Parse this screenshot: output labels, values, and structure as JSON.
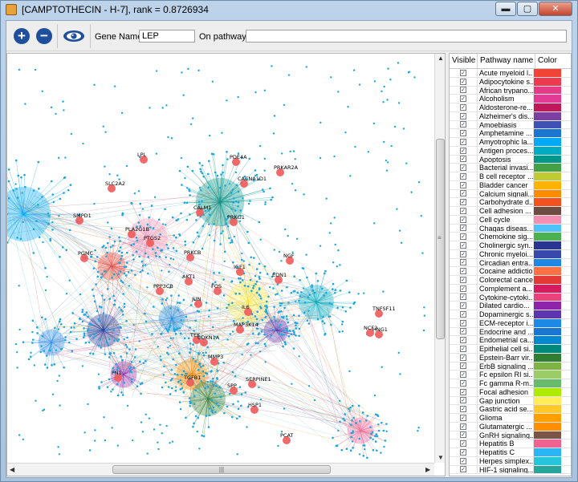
{
  "window": {
    "title": "[CAMPTOTHECIN - H-7], rank = 0.8726934",
    "minimize_label": "▬",
    "maximize_label": "▢",
    "close_label": "✕"
  },
  "toolbar": {
    "zoom_in_label": "+",
    "zoom_out_label": "−",
    "gene_name_label": "Gene Name:",
    "gene_name_value": "LEP",
    "pathways_label": "On pathways:",
    "pathways_value": ""
  },
  "graph": {
    "nodes": [
      {
        "label": "LPL"
      },
      {
        "label": "PDE4A"
      },
      {
        "label": "PRKAR2A"
      },
      {
        "label": "SLC2A2"
      },
      {
        "label": "CACNA1D1"
      },
      {
        "label": "CALM1"
      },
      {
        "label": "SMPD1"
      },
      {
        "label": "PRKG1"
      },
      {
        "label": "PLA2G1B"
      },
      {
        "label": "PTGS2"
      },
      {
        "label": "PGMC"
      },
      {
        "label": "PRKCB"
      },
      {
        "label": "IGF1"
      },
      {
        "label": "NGF"
      },
      {
        "label": "EDN1"
      },
      {
        "label": "AKT1"
      },
      {
        "label": "PPP3CB"
      },
      {
        "label": "FOS"
      },
      {
        "label": "JUN"
      },
      {
        "label": "IL6"
      },
      {
        "label": "TNFSF11"
      },
      {
        "label": "NCF2"
      },
      {
        "label": "MAP3K14"
      },
      {
        "label": "TEK"
      },
      {
        "label": "CDKN1A"
      },
      {
        "label": "HNG1"
      },
      {
        "label": "MMP3"
      },
      {
        "label": "FN1"
      },
      {
        "label": "TGFB1"
      },
      {
        "label": "SERPINE1"
      },
      {
        "label": "SPP"
      },
      {
        "label": "HSP1"
      },
      {
        "label": "PCAT"
      }
    ],
    "hscroll_grip": "|||",
    "vscroll_grip": "≡"
  },
  "table": {
    "headers": [
      "Visible",
      "Pathway name",
      "Color"
    ],
    "rows": [
      {
        "name": "Acute myeloid l...",
        "color": "#f04437"
      },
      {
        "name": "Adipocytokine s...",
        "color": "#ee3a4f"
      },
      {
        "name": "African trypano...",
        "color": "#e73a86"
      },
      {
        "name": "Alcoholism",
        "color": "#e23b95"
      },
      {
        "name": "Aldosterone-re...",
        "color": "#c2185b"
      },
      {
        "name": "Alzheimer's dis...",
        "color": "#7b3fa0"
      },
      {
        "name": "Amoebiasis",
        "color": "#3f51b5"
      },
      {
        "name": "Amphetamine ...",
        "color": "#1976d2"
      },
      {
        "name": "Amyotrophic la...",
        "color": "#03a9f4"
      },
      {
        "name": "Antigen proces...",
        "color": "#00acc1"
      },
      {
        "name": "Apoptosis",
        "color": "#009688"
      },
      {
        "name": "Bacterial invasi...",
        "color": "#43a047"
      },
      {
        "name": "B cell receptor ...",
        "color": "#c0ca33"
      },
      {
        "name": "Bladder cancer",
        "color": "#ffb300"
      },
      {
        "name": "Calcium signali...",
        "color": "#fb8c00"
      },
      {
        "name": "Carbohydrate d...",
        "color": "#f4511e"
      },
      {
        "name": "Cell adhesion ...",
        "color": "#6d4c41"
      },
      {
        "name": "Cell cycle",
        "color": "#f48fb1"
      },
      {
        "name": "Chagas diseas...",
        "color": "#4fc3f7"
      },
      {
        "name": "Chemokine sig...",
        "color": "#4caf50"
      },
      {
        "name": "Cholinergic syn...",
        "color": "#283593"
      },
      {
        "name": "Chronic myeloi...",
        "color": "#3949ab"
      },
      {
        "name": "Circadian entra...",
        "color": "#1e88e5"
      },
      {
        "name": "Cocaine addiction",
        "color": "#ff7043"
      },
      {
        "name": "Colorectal cancer",
        "color": "#e53935"
      },
      {
        "name": "Complement a...",
        "color": "#d81b60"
      },
      {
        "name": "Cytokine-cytoki...",
        "color": "#ec407a"
      },
      {
        "name": "Dilated cardio...",
        "color": "#8e24aa"
      },
      {
        "name": "Dopaminergic s...",
        "color": "#5e35b1"
      },
      {
        "name": "ECM-receptor i...",
        "color": "#1e88e5"
      },
      {
        "name": "Endocrine and ...",
        "color": "#1976d2"
      },
      {
        "name": "Endometrial ca...",
        "color": "#0288d1"
      },
      {
        "name": "Epithelial cell si...",
        "color": "#00897b"
      },
      {
        "name": "Epstein-Barr vir...",
        "color": "#2e7d32"
      },
      {
        "name": "ErbB signaling ...",
        "color": "#7cb342"
      },
      {
        "name": "Fc epsilon RI si...",
        "color": "#9ccc65"
      },
      {
        "name": "Fc gamma R-m...",
        "color": "#66bb6a"
      },
      {
        "name": "Focal adhesion",
        "color": "#aeea00"
      },
      {
        "name": "Gap junction",
        "color": "#ffee58"
      },
      {
        "name": "Gastric acid se...",
        "color": "#ffca28"
      },
      {
        "name": "Glioma",
        "color": "#ffa000"
      },
      {
        "name": "Glutamatergic ...",
        "color": "#ff8f00"
      },
      {
        "name": "GnRH signaling...",
        "color": "#795548"
      },
      {
        "name": "Hepatitis B",
        "color": "#f06292"
      },
      {
        "name": "Hepatitis C",
        "color": "#29b6f6"
      },
      {
        "name": "Herpes simplex...",
        "color": "#26c6da"
      },
      {
        "name": "HIF-1 signaling...",
        "color": "#26a69a"
      }
    ]
  }
}
